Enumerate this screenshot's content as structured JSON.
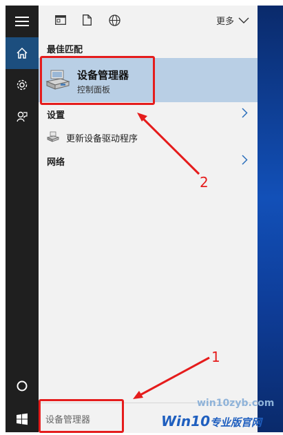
{
  "toolbar": {
    "more_label": "更多"
  },
  "best_match": {
    "header": "最佳匹配",
    "title": "设备管理器",
    "subtitle": "控制面板"
  },
  "settings_row": {
    "label": "设置"
  },
  "settings_item": {
    "label": "更新设备驱动程序"
  },
  "network_row": {
    "label": "网络"
  },
  "search": {
    "value": "设备管理器"
  },
  "annotations": {
    "one": "1",
    "two": "2"
  },
  "watermark": {
    "site": "win10zyb.com",
    "brand": "Win10",
    "brand_cn": "专业版官网"
  },
  "colors": {
    "accent": "#1c4e7e",
    "highlight": "#b9cfe5",
    "annotation": "#e51c1c"
  }
}
